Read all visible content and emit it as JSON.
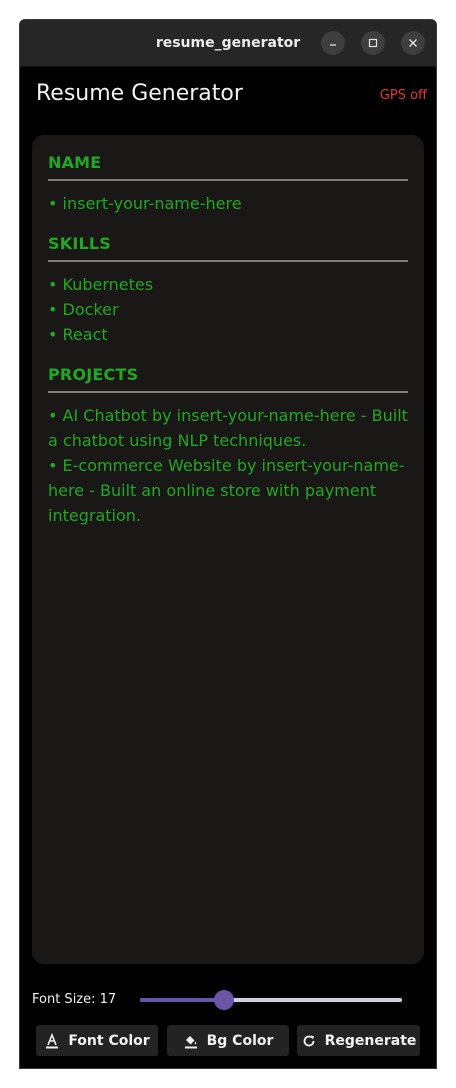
{
  "window": {
    "title": "resume_generator",
    "controls": [
      "minimize",
      "maximize",
      "close"
    ]
  },
  "header": {
    "title": "Resume Generator",
    "gps_status": "GPS off"
  },
  "resume": {
    "sections": [
      {
        "heading": "NAME",
        "items": [
          "• insert-your-name-here"
        ]
      },
      {
        "heading": "SKILLS",
        "items": [
          "• Kubernetes",
          "• Docker",
          "• React"
        ]
      },
      {
        "heading": "PROJECTS",
        "items": [
          "• AI Chatbot by insert-your-name-here - Built a chatbot using NLP techniques.",
          "• E-commerce Website by insert-your-name-here - Built an online store with payment integration."
        ]
      }
    ]
  },
  "font_size": {
    "label": "Font Size: 17",
    "value": 17,
    "slider_fraction": 0.32
  },
  "actions": {
    "font_color": "Font Color",
    "bg_color": "Bg Color",
    "regenerate": "Regenerate"
  },
  "colors": {
    "resume_text": "#22a822",
    "card_bg": "#1a1717",
    "gps_off": "#e53935",
    "slider_accent": "#6a54a8"
  },
  "icons": {
    "font_color": "font-color-icon",
    "bg_color": "paint-bucket-icon",
    "regenerate": "refresh-icon"
  }
}
